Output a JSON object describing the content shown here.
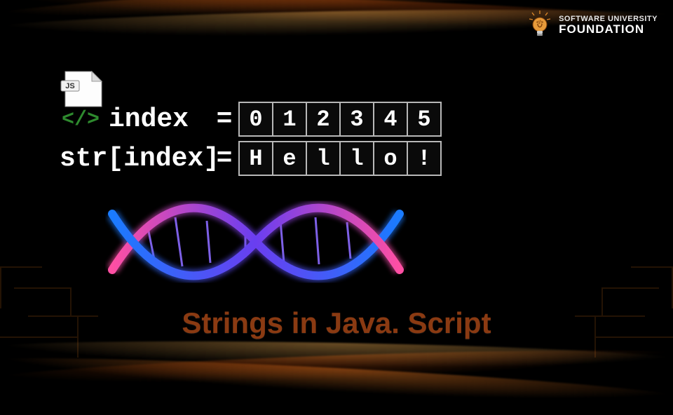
{
  "brand": {
    "line1": "SOFTWARE UNIVERSITY",
    "line2": "FOUNDATION"
  },
  "file_tag": "JS",
  "code": {
    "row1_label": "index",
    "row2_label": "str[index]",
    "eq": "=",
    "indices": [
      "0",
      "1",
      "2",
      "3",
      "4",
      "5"
    ],
    "chars": [
      "H",
      "e",
      "l",
      "l",
      "o",
      "!"
    ]
  },
  "title": "Strings in Java. Script"
}
